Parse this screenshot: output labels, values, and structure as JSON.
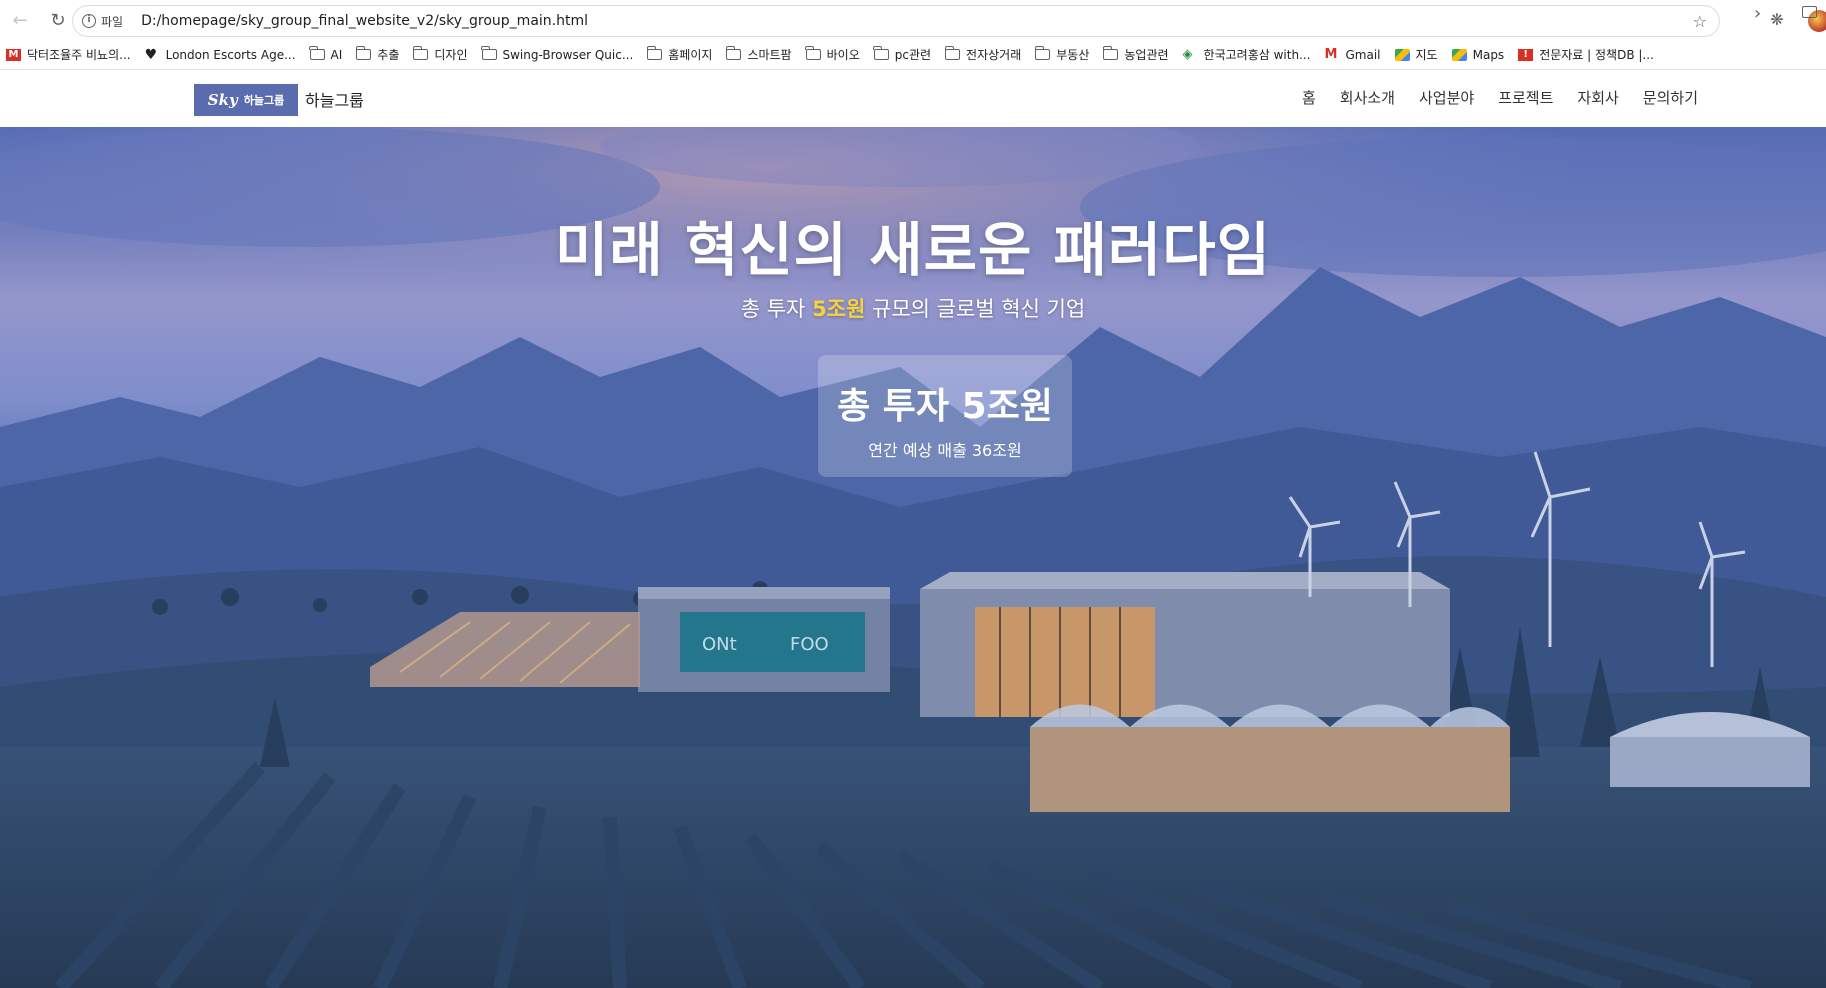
{
  "browser": {
    "page_info_chip": "파일",
    "url": "D:/homepage/sky_group_final_website_v2/sky_group_main.html"
  },
  "bookmarks": [
    {
      "label": "닥터조율주 비뇨의...",
      "icon": "gm"
    },
    {
      "label": "London Escorts Age...",
      "icon": "heart"
    },
    {
      "label": "AI",
      "icon": "folder"
    },
    {
      "label": "추출",
      "icon": "folder"
    },
    {
      "label": "디자인",
      "icon": "folder"
    },
    {
      "label": "Swing-Browser Quic...",
      "icon": "folder"
    },
    {
      "label": "홈페이지",
      "icon": "folder"
    },
    {
      "label": "스마트팜",
      "icon": "folder"
    },
    {
      "label": "바이오",
      "icon": "folder"
    },
    {
      "label": "pc관련",
      "icon": "folder"
    },
    {
      "label": "전자상거래",
      "icon": "folder"
    },
    {
      "label": "부동산",
      "icon": "folder"
    },
    {
      "label": "농업관련",
      "icon": "folder"
    },
    {
      "label": "한국고려홍삼 with...",
      "icon": "shield"
    },
    {
      "label": "Gmail",
      "icon": "gmail"
    },
    {
      "label": "지도",
      "icon": "maps"
    },
    {
      "label": "Maps",
      "icon": "maps"
    },
    {
      "label": "전문자료 | 정책DB |...",
      "icon": "red"
    }
  ],
  "header": {
    "logo_script": "Sky",
    "logo_small": "하늘그룹",
    "brand_name": "하늘그룹",
    "nav": [
      "홈",
      "회사소개",
      "사업분야",
      "프로젝트",
      "자회사",
      "문의하기"
    ]
  },
  "hero": {
    "title": "미래 혁신의 새로운 패러다임",
    "subtitle_prefix": "총 투자",
    "subtitle_highlight": "5조원",
    "subtitle_suffix": "규모의 글로벌 혁신 기업",
    "stat_big": "총 투자 5조원",
    "stat_small": "연간 예상 매출 36조원",
    "signage_text": [
      "ONt",
      "FOO"
    ]
  },
  "colors": {
    "logo_bg": "#5a6cae",
    "highlight": "#f7d33b",
    "hero_overlay": "#4a5fa8"
  }
}
